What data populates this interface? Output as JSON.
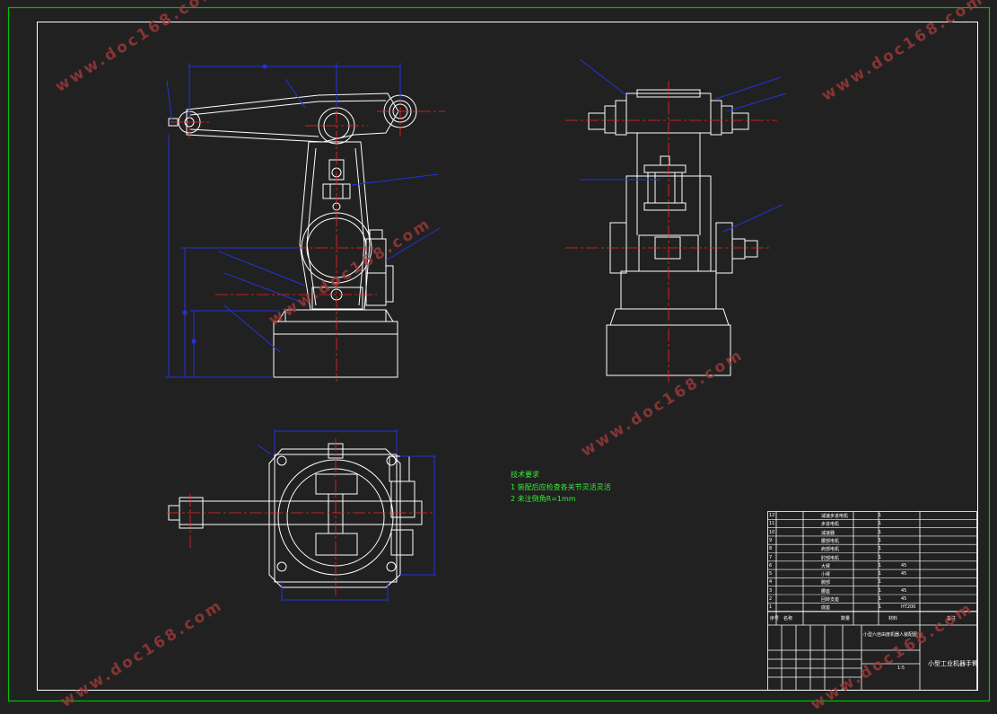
{
  "tech_notes": {
    "heading": "技术要求",
    "line1": "1 装配后应检查各关节灵活灵活",
    "line2": "2 未注倒角R=1mm"
  },
  "watermark": "www.doc168.com",
  "title_block": {
    "drawing_title": "小型工业机器手臂",
    "assembly_name": "小型六自由度机器人装配图",
    "scale": "1:5",
    "header_no": "序号",
    "header_name": "名称",
    "header_qty": "数量",
    "header_material": "材料",
    "header_remark": "备注",
    "parts": [
      {
        "no": "12",
        "name": "减速步进电机",
        "qty": "1",
        "material": ""
      },
      {
        "no": "11",
        "name": "步进电机",
        "qty": "1",
        "material": ""
      },
      {
        "no": "10",
        "name": "减速器",
        "qty": "1",
        "material": ""
      },
      {
        "no": "9",
        "name": "腰部电机",
        "qty": "1",
        "material": ""
      },
      {
        "no": "8",
        "name": "肩部电机",
        "qty": "1",
        "material": ""
      },
      {
        "no": "7",
        "name": "肘部电机",
        "qty": "1",
        "material": ""
      },
      {
        "no": "6",
        "name": "大臂",
        "qty": "1",
        "material": "45"
      },
      {
        "no": "5",
        "name": "小臂",
        "qty": "1",
        "material": "45"
      },
      {
        "no": "4",
        "name": "腕部",
        "qty": "1",
        "material": ""
      },
      {
        "no": "3",
        "name": "腰座",
        "qty": "1",
        "material": "45"
      },
      {
        "no": "2",
        "name": "回转支座",
        "qty": "1",
        "material": "45"
      },
      {
        "no": "1",
        "name": "底座",
        "qty": "1",
        "material": "HT200"
      }
    ]
  },
  "colors": {
    "background": "#212121",
    "outline": "#ffffff",
    "centerline": "#ff2020",
    "dimension": "#2233dd",
    "frame": "#00c000",
    "note": "#33ee33",
    "watermark": "#a33a3a"
  }
}
